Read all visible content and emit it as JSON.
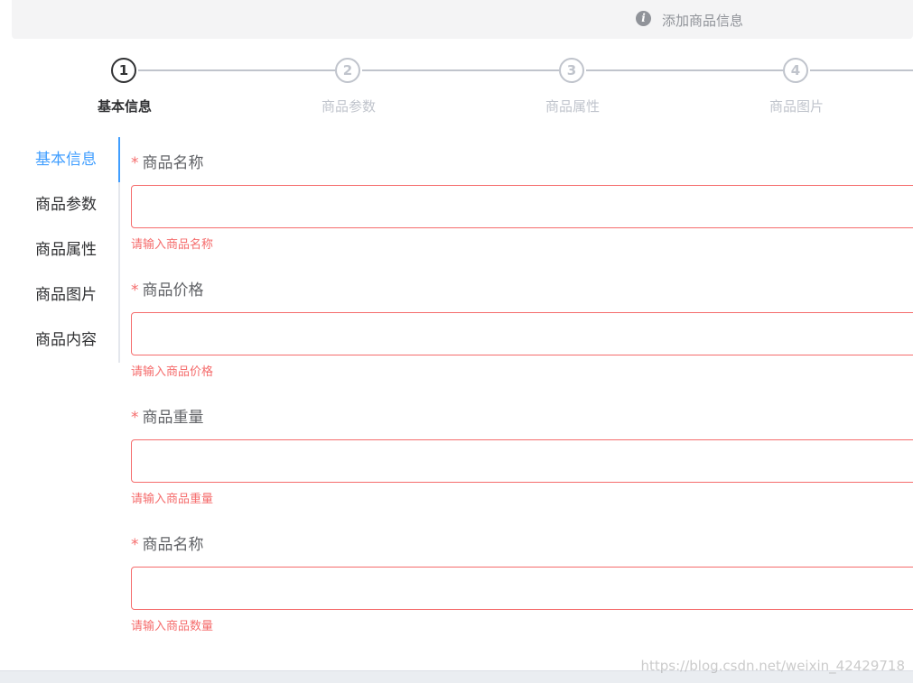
{
  "alert": {
    "icon": "info-icon",
    "title": "添加商品信息"
  },
  "steps": [
    {
      "number": "1",
      "title": "基本信息"
    },
    {
      "number": "2",
      "title": "商品参数"
    },
    {
      "number": "3",
      "title": "商品属性"
    },
    {
      "number": "4",
      "title": "商品图片"
    }
  ],
  "tabs": [
    {
      "label": "基本信息"
    },
    {
      "label": "商品参数"
    },
    {
      "label": "商品属性"
    },
    {
      "label": "商品图片"
    },
    {
      "label": "商品内容"
    }
  ],
  "form": {
    "items": [
      {
        "required_mark": "*",
        "label": "商品名称",
        "value": "",
        "error": "请输入商品名称"
      },
      {
        "required_mark": "*",
        "label": "商品价格",
        "value": "",
        "error": "请输入商品价格"
      },
      {
        "required_mark": "*",
        "label": "商品重量",
        "value": "",
        "error": "请输入商品重量"
      },
      {
        "required_mark": "*",
        "label": "商品名称",
        "value": "",
        "error": "请输入商品数量"
      }
    ]
  },
  "watermark": "https://blog.csdn.net/weixin_42429718",
  "colors": {
    "primary": "#409eff",
    "danger": "#f56c6c",
    "info": "#909399",
    "text": "#303133"
  }
}
